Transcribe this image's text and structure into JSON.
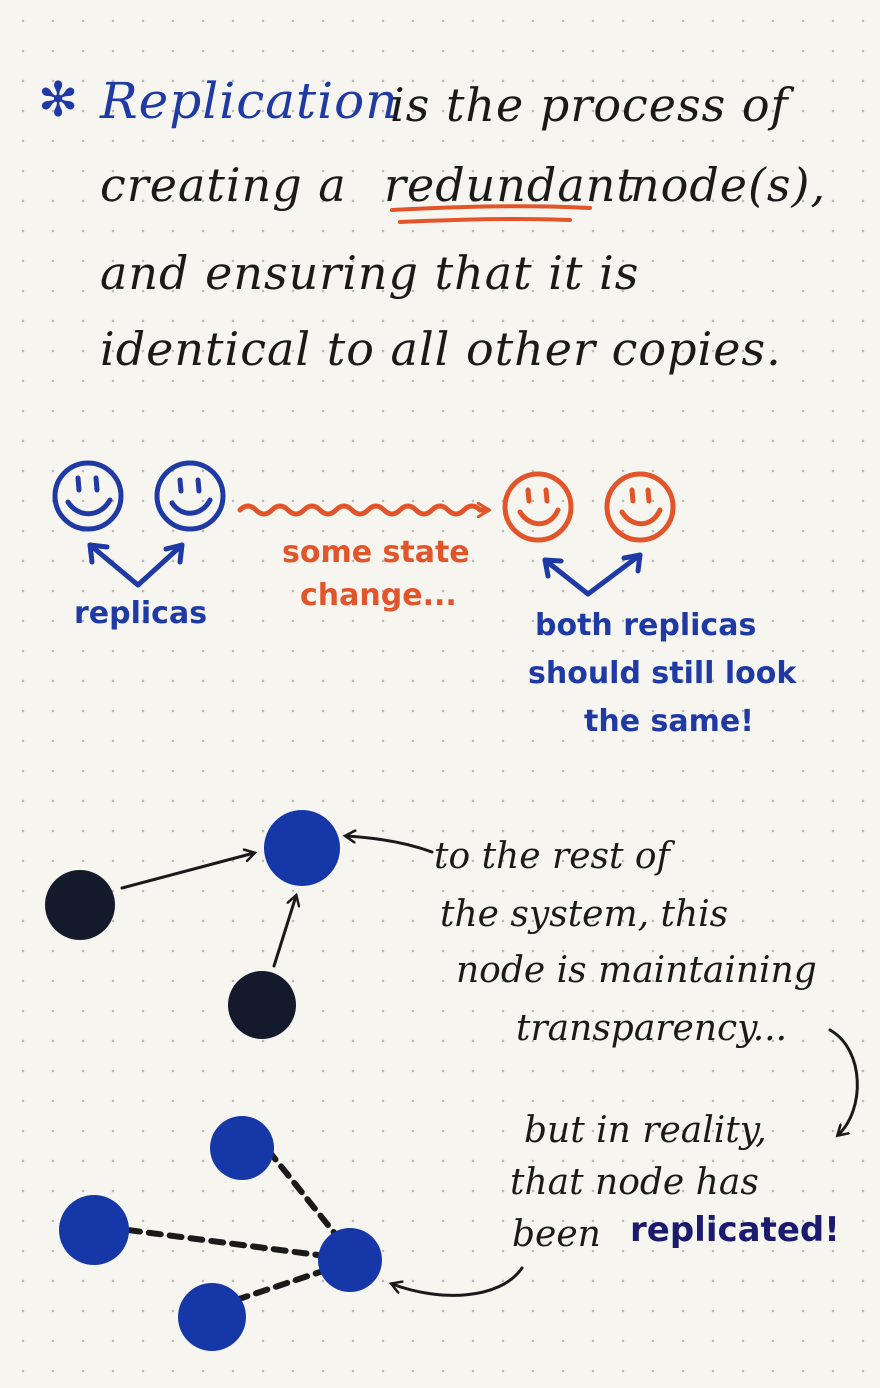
{
  "definition": {
    "asterisk": "✻",
    "term": "Replication",
    "line1_rest": "is the process of",
    "line2_pre": "creating a",
    "line2_emph": "redundant",
    "line2_post": "node(s),",
    "line3": "and ensuring that it is",
    "line4": "identical to all other copies."
  },
  "replicas_section": {
    "left_label": "replicas",
    "middle_label_line1": "some state",
    "middle_label_line2": "change...",
    "right_label_line1": "both replicas",
    "right_label_line2": "should still look",
    "right_label_line3": "the same!"
  },
  "transparency_section": {
    "note_line1": "to the rest of",
    "note_line2": "the system, this",
    "note_line3": "node is maintaining",
    "note_line4": "transparency...",
    "reality_line1": "but in reality,",
    "reality_line2": "that node has",
    "reality_line3_pre": "been",
    "reality_line3_emph": "replicated!"
  },
  "colors": {
    "ink_blue": "#1f3aa5",
    "ink_orange": "#e2552a",
    "ink_black": "#1a1a1a",
    "node_blue": "#1537a8",
    "node_black": "#131a2b"
  }
}
